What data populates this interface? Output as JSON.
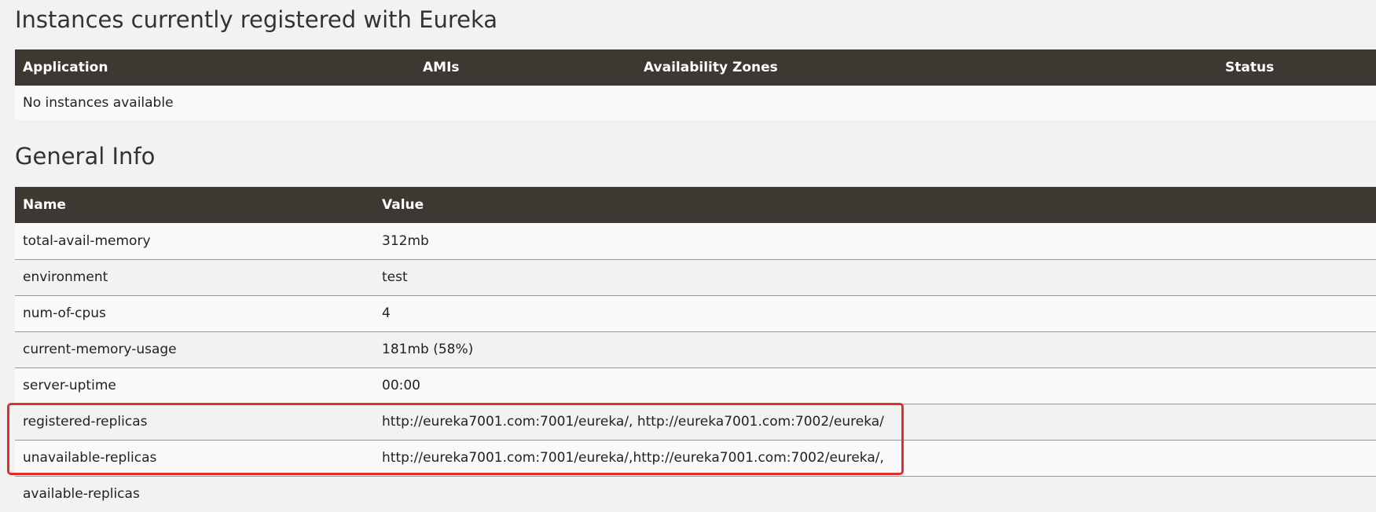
{
  "instances": {
    "title": "Instances currently registered with Eureka",
    "columns": [
      "Application",
      "AMIs",
      "Availability Zones",
      "Status"
    ],
    "empty_message": "No instances available"
  },
  "general": {
    "title": "General Info",
    "columns": [
      "Name",
      "Value"
    ],
    "rows": [
      {
        "name": "total-avail-memory",
        "value": "312mb"
      },
      {
        "name": "environment",
        "value": "test"
      },
      {
        "name": "num-of-cpus",
        "value": "4"
      },
      {
        "name": "current-memory-usage",
        "value": "181mb (58%)"
      },
      {
        "name": "server-uptime",
        "value": "00:00"
      },
      {
        "name": "registered-replicas",
        "value": "http://eureka7001.com:7001/eureka/, http://eureka7001.com:7002/eureka/"
      },
      {
        "name": "unavailable-replicas",
        "value": "http://eureka7001.com:7001/eureka/,http://eureka7001.com:7002/eureka/,"
      },
      {
        "name": "available-replicas",
        "value": ""
      }
    ]
  },
  "annotation": {
    "highlight_color": "#e02f2a"
  },
  "colors": {
    "header_bg": "#3d3832",
    "header_text": "#ffffff",
    "page_bg": "#f2f2f2"
  }
}
